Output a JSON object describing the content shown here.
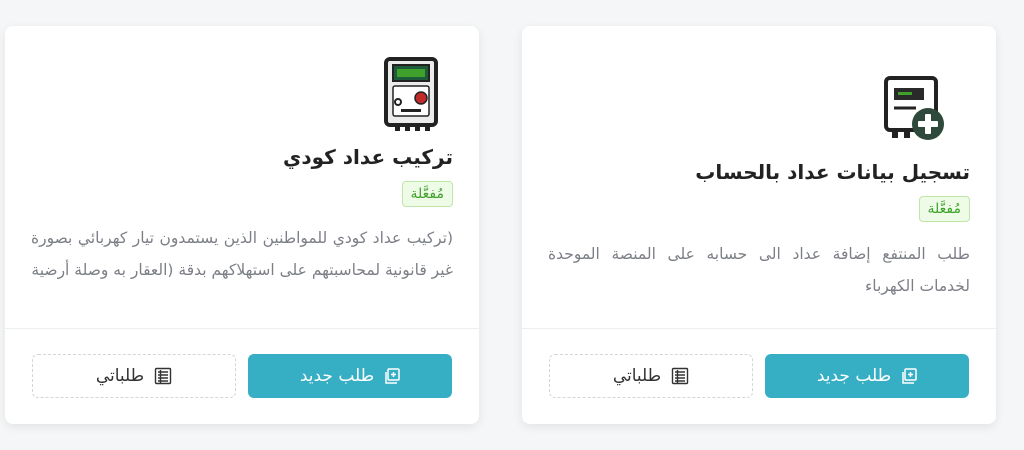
{
  "cards": [
    {
      "title": "تسجيل بيانات عداد بالحساب",
      "status": "مُفعَّلة",
      "description": "طلب المنتفع إضافة عداد الى حسابه على المنصة الموحدة لخدمات الكهرباء",
      "new_request_label": "طلب جديد",
      "my_requests_label": "طلباتي",
      "icon": "meter-add-icon"
    },
    {
      "title": "تركيب عداد كودي",
      "status": "مُفعَّلة",
      "description": "(تركيب عداد كودي للمواطنين الذين يستمدون تيار كهربائي بصورة غير قانونية لمحاسبتهم على استهلاكهم بدقة (العقار به وصلة أرضية",
      "new_request_label": "طلب جديد",
      "my_requests_label": "طلباتي",
      "icon": "coded-meter-icon"
    }
  ],
  "colors": {
    "primary": "#36aec4",
    "badge_bg": "#eefbe7",
    "badge_text": "#3fa12c"
  }
}
